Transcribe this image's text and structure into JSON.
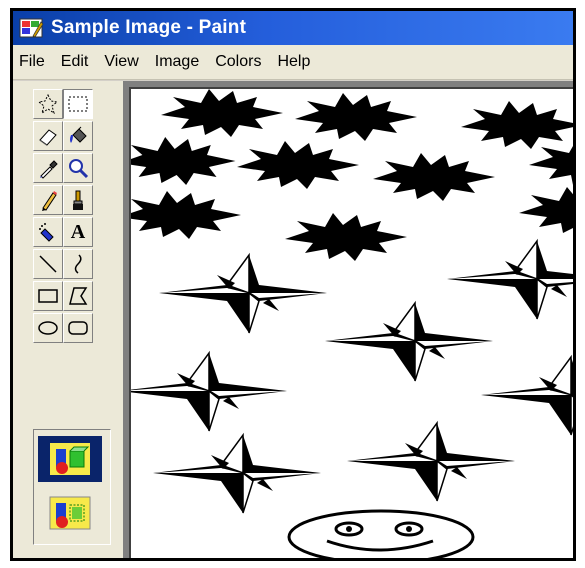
{
  "window": {
    "title": "Sample Image - Paint",
    "icon": "paint-app-icon"
  },
  "menu": [
    {
      "label": "File"
    },
    {
      "label": "Edit"
    },
    {
      "label": "View"
    },
    {
      "label": "Image"
    },
    {
      "label": "Colors"
    },
    {
      "label": "Help"
    }
  ],
  "tools": [
    {
      "name": "free-form-select",
      "icon": "freeform-select-icon",
      "selected": false
    },
    {
      "name": "select",
      "icon": "rect-select-icon",
      "selected": true
    },
    {
      "name": "eraser",
      "icon": "eraser-icon",
      "selected": false
    },
    {
      "name": "fill-with-color",
      "icon": "paint-bucket-icon",
      "selected": false
    },
    {
      "name": "pick-color",
      "icon": "eyedropper-icon",
      "selected": false
    },
    {
      "name": "magnifier",
      "icon": "magnifier-icon",
      "selected": false
    },
    {
      "name": "pencil",
      "icon": "pencil-icon",
      "selected": false
    },
    {
      "name": "brush",
      "icon": "brush-icon",
      "selected": false
    },
    {
      "name": "airbrush",
      "icon": "airbrush-icon",
      "selected": false
    },
    {
      "name": "text",
      "icon": "text-icon",
      "label": "A",
      "selected": false
    },
    {
      "name": "line",
      "icon": "line-icon",
      "selected": false
    },
    {
      "name": "curve",
      "icon": "curve-icon",
      "selected": false
    },
    {
      "name": "rectangle",
      "icon": "rectangle-icon",
      "selected": false
    },
    {
      "name": "polygon",
      "icon": "polygon-icon",
      "selected": false
    },
    {
      "name": "ellipse",
      "icon": "ellipse-icon",
      "selected": false
    },
    {
      "name": "rounded-rectangle",
      "icon": "rounded-rect-icon",
      "selected": false
    }
  ],
  "selection_options": [
    {
      "name": "opaque-selection",
      "icon": "opaque-selection-icon",
      "selected": true
    },
    {
      "name": "transparent-selection",
      "icon": "transparent-selection-icon",
      "selected": false
    }
  ],
  "colors": {
    "titlebar_start": "#0a3fa8",
    "titlebar_end": "#3a7bf0",
    "chrome": "#ece9d8",
    "selected_option": "#0a246a"
  }
}
